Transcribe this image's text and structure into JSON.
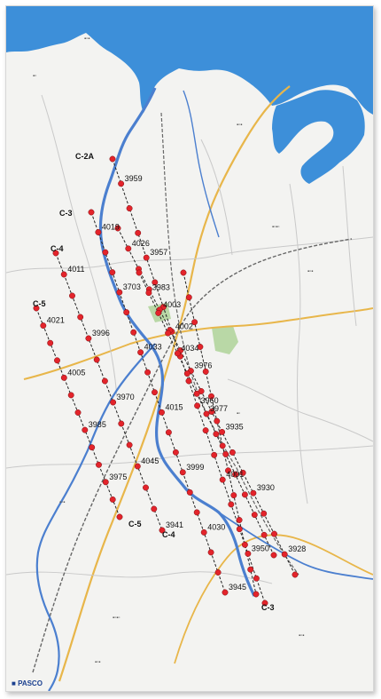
{
  "map": {
    "credit": "PASCO",
    "colors": {
      "sea": "#3d8fd9",
      "river": "#4b7fcf",
      "land": "#f3f3f1",
      "road_major": "#e8b64a",
      "road_minor": "#c9c9c9",
      "rail": "#666666",
      "green": "#b9d8a6",
      "survey_line": "#222222",
      "survey_point": "#e3242b"
    },
    "line_labels": [
      {
        "id": "C-2A",
        "text": "C-2A"
      },
      {
        "id": "C-3",
        "text": "C-3"
      },
      {
        "id": "C-4",
        "text": "C-4"
      },
      {
        "id": "C-5",
        "text": "C-5"
      },
      {
        "id": "C-5b",
        "text": "C-5"
      },
      {
        "id": "C-4b",
        "text": "C-4"
      },
      {
        "id": "C-3b",
        "text": "C-3"
      }
    ],
    "point_labels": [
      "3959",
      "3957",
      "4002",
      "3960",
      "4001",
      "3950",
      "4019",
      "3703",
      "4033",
      "4015",
      "3999",
      "4030",
      "3945",
      "4011",
      "3996",
      "3970",
      "4045",
      "3941",
      "4021",
      "4005",
      "3985",
      "3975",
      "4026",
      "4003",
      "3976",
      "3935",
      "3930",
      "3928",
      "3983",
      "4034",
      "3977"
    ]
  }
}
